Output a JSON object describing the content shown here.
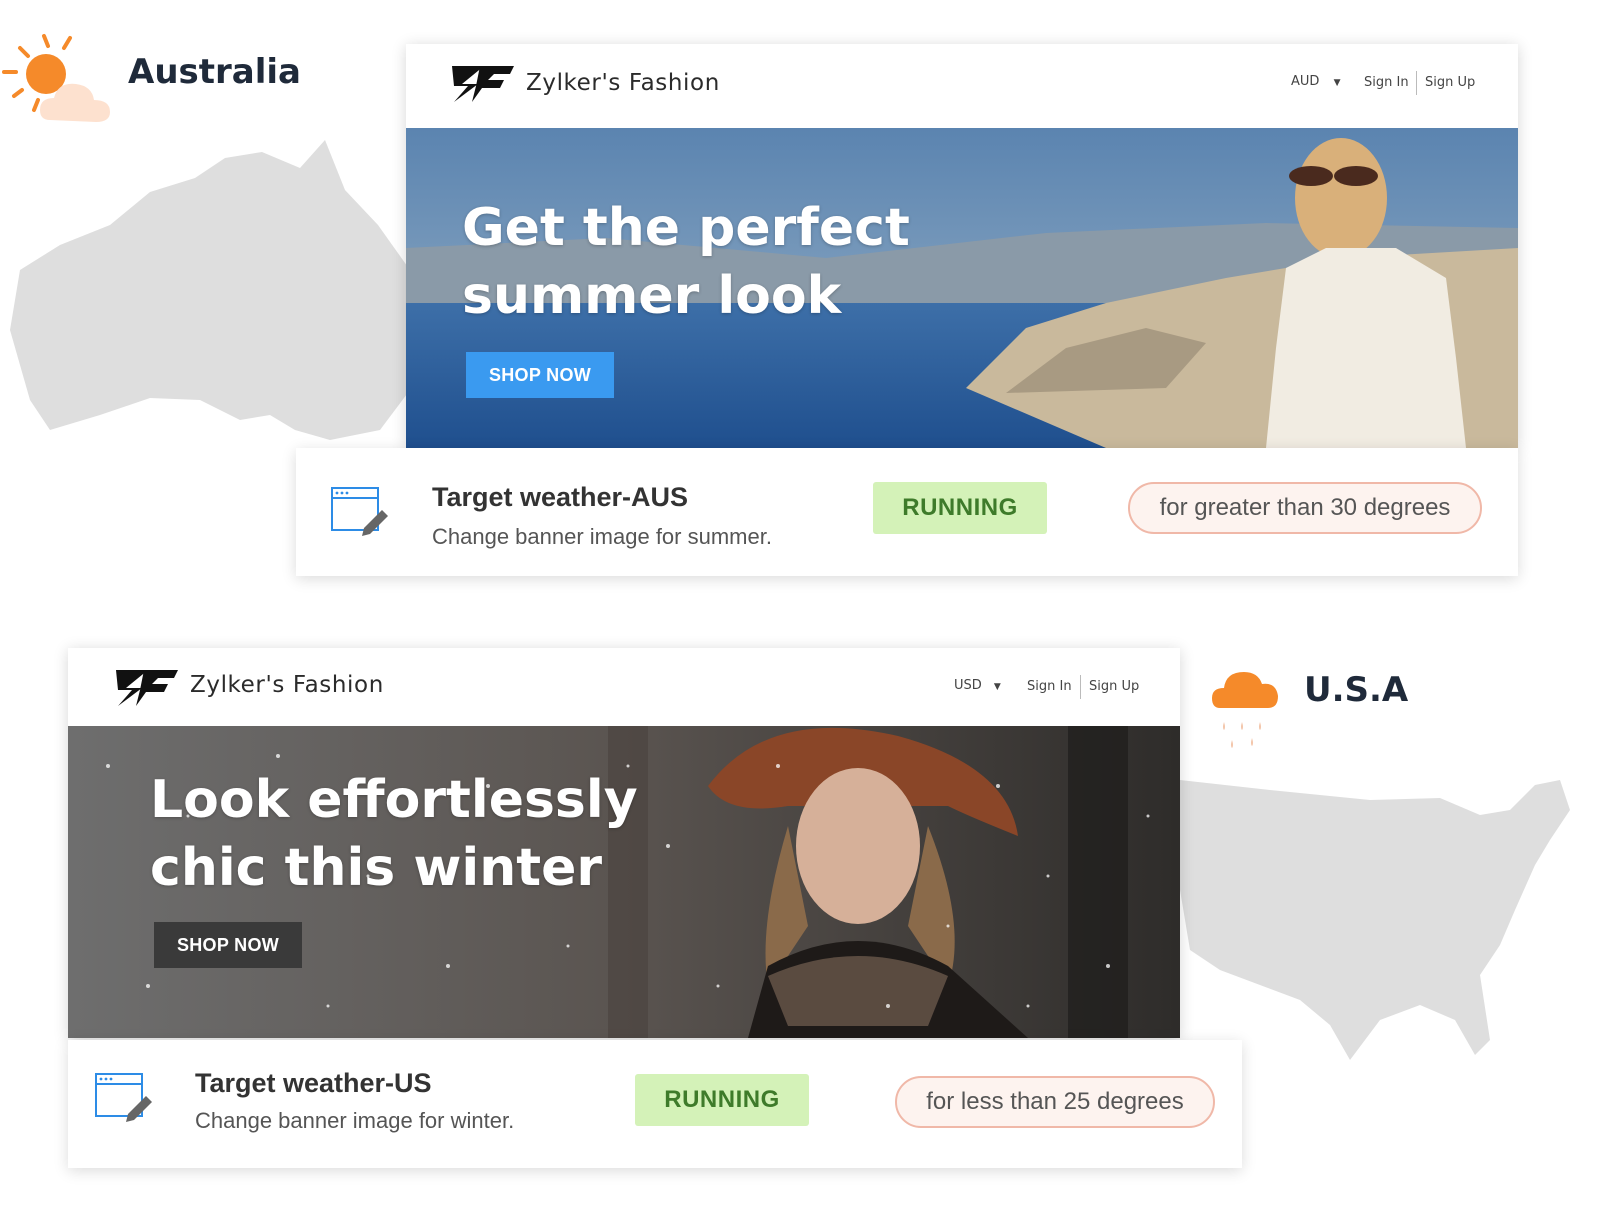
{
  "regions": {
    "australia": {
      "label": "Australia",
      "weather_icon": "sun-cloud-icon",
      "map": "australia-map"
    },
    "usa": {
      "label": "U.S.A",
      "weather_icon": "rain-cloud-icon",
      "map": "usa-map"
    }
  },
  "colors": {
    "accent_orange": "#f58a2a",
    "running_bg": "#d4f2b8",
    "running_text": "#3e7b2a",
    "condition_border": "#f0b8a8",
    "summer_button": "#3a9af0",
    "winter_button": "#3a3a3a"
  },
  "site_aus": {
    "brand": "Zylker's Fashion",
    "currency": "AUD",
    "signin": "Sign In",
    "signup": "Sign Up",
    "banner_title_line1": "Get the perfect",
    "banner_title_line2": "summer look",
    "shop_label": "SHOP NOW"
  },
  "site_us": {
    "brand": "Zylker's Fashion",
    "currency": "USD",
    "signin": "Sign In",
    "signup": "Sign Up",
    "banner_title_line1": "Look effortlessly",
    "banner_title_line2": "chic this winter",
    "shop_label": "SHOP NOW"
  },
  "campaign_aus": {
    "title": "Target weather-AUS",
    "description": "Change banner image for summer.",
    "status": "RUNNING",
    "condition": "for greater than 30 degrees"
  },
  "campaign_us": {
    "title": "Target weather-US",
    "description": "Change banner image for winter.",
    "status": "RUNNING",
    "condition": "for less than 25 degrees"
  }
}
